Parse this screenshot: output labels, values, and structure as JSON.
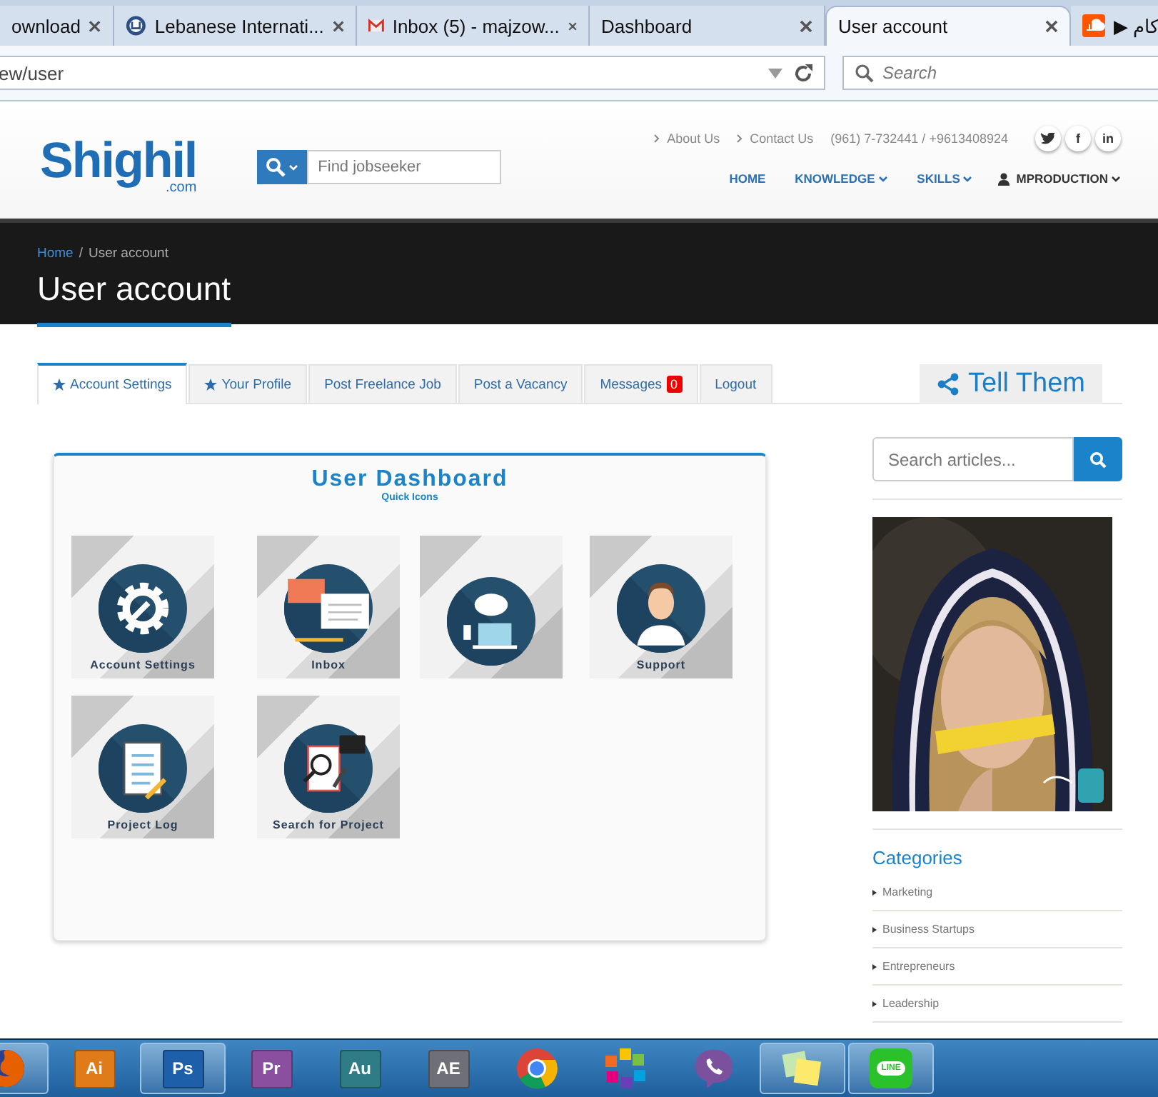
{
  "browser": {
    "tabs": [
      {
        "title": "ownload",
        "selected": false,
        "kind": "plain",
        "closable": true
      },
      {
        "title": "Lebanese Internati...",
        "selected": false,
        "kind": "seal",
        "closable": true
      },
      {
        "title": "Inbox (5) - majzow...",
        "selected": false,
        "kind": "mail",
        "closable": true
      },
      {
        "title": "Dashboard",
        "selected": false,
        "kind": "plain",
        "closable": true
      },
      {
        "title": "User account",
        "selected": true,
        "kind": "plain",
        "closable": true
      },
      {
        "title": "▶ كام",
        "selected": false,
        "kind": "cloud",
        "closable": false
      }
    ],
    "address": "ew/user",
    "search_placeholder": "Search"
  },
  "header": {
    "logo": "Shighil",
    "logo_suffix": ".com",
    "search_placeholder": "Find jobseeker",
    "top_links": [
      "About Us",
      "Contact Us"
    ],
    "phone": "(961) 7-732441 / +9613408924",
    "social": [
      {
        "kind": "bird"
      },
      {
        "kind": "text",
        "label": "f"
      },
      {
        "kind": "text",
        "label": "in"
      }
    ],
    "nav": [
      {
        "label": "HOME",
        "kind": "link",
        "dropdown": false
      },
      {
        "label": "KNOWLEDGE",
        "kind": "link",
        "dropdown": true
      },
      {
        "label": "SKILLS",
        "kind": "link",
        "dropdown": true
      },
      {
        "label": "MPRODUCTION",
        "kind": "user",
        "dropdown": true
      }
    ]
  },
  "banner": {
    "breadcrumb": [
      {
        "label": "Home",
        "kind": "link"
      },
      {
        "label": "User account",
        "kind": "current"
      }
    ],
    "separator": "/",
    "title": "User account"
  },
  "account_tabs": [
    {
      "label": "Account Settings",
      "selected": true,
      "starred": true
    },
    {
      "label": "Your Profile",
      "selected": false,
      "starred": true
    },
    {
      "label": "Post Freelance Job",
      "selected": false,
      "starred": false
    },
    {
      "label": "Post a Vacancy",
      "selected": false,
      "starred": false
    },
    {
      "label": "Messages",
      "selected": false,
      "starred": false,
      "badge": "0"
    },
    {
      "label": "Logout",
      "selected": false,
      "starred": false
    }
  ],
  "share_button": "Tell Them",
  "dashboard": {
    "title": "User Dashboard",
    "subtitle": "Quick Icons",
    "tiles": [
      {
        "kind": "settings",
        "label": "Account Settings"
      },
      {
        "kind": "inbox",
        "label": "Inbox"
      },
      {
        "kind": "network"
      },
      {
        "kind": "support",
        "label": "Support"
      },
      {
        "kind": "log",
        "label": "Project Log"
      },
      {
        "kind": "search",
        "label": "Search for Project"
      }
    ]
  },
  "sidebar": {
    "search_placeholder": "Search articles...",
    "categories_title": "Categories",
    "categories": [
      "Marketing",
      "Business Startups",
      "Entrepreneurs",
      "Leadership"
    ]
  },
  "taskbar": [
    {
      "kind": "firefox",
      "active": true
    },
    {
      "kind": "app",
      "label": "Ai",
      "color": "#e07b1a",
      "active": false
    },
    {
      "kind": "app",
      "label": "Ps",
      "color": "#1d5fa8",
      "active": true
    },
    {
      "kind": "app",
      "label": "Pr",
      "color": "#8a4f9e",
      "active": false
    },
    {
      "kind": "app",
      "label": "Au",
      "color": "#2f7c86",
      "active": false
    },
    {
      "kind": "app",
      "label": "AE",
      "color": "#6f6f78",
      "active": false
    },
    {
      "kind": "chrome",
      "active": false
    },
    {
      "kind": "pinwheel",
      "active": false
    },
    {
      "kind": "viber",
      "active": false
    },
    {
      "kind": "notes",
      "active": true
    },
    {
      "kind": "line",
      "label": "LINE",
      "active": true
    }
  ]
}
